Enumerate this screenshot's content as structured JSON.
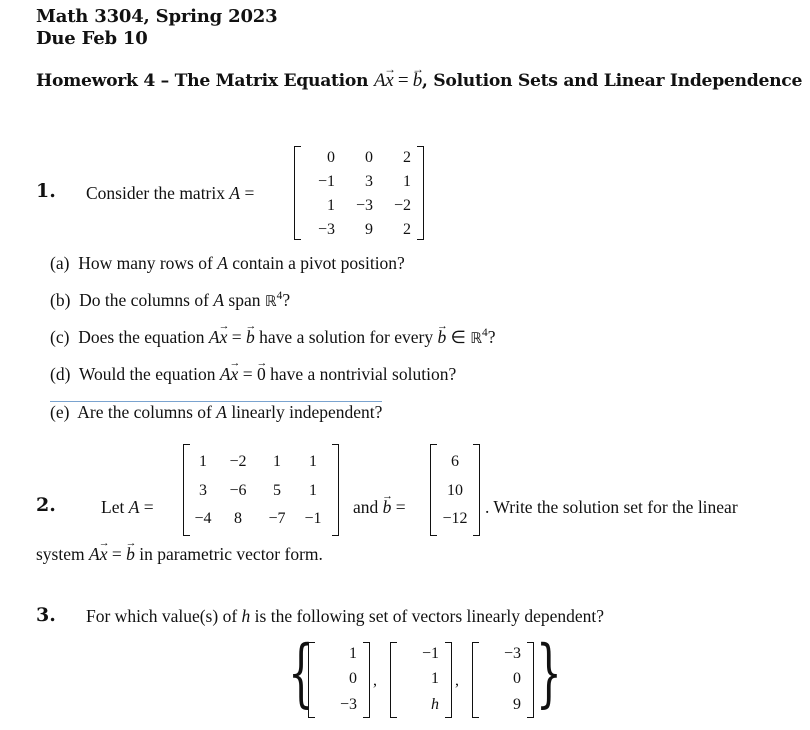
{
  "header": {
    "course": "Math 3304, Spring 2023",
    "due": "Due Feb 10"
  },
  "title": {
    "prefix": "Homework 4 – The Matrix Equation ",
    "eq_A": "A",
    "eq_x": "x",
    "eq_equals": " = ",
    "eq_b": "b",
    "suffix": ", Solution Sets and Linear Independence"
  },
  "problem1": {
    "number": "1.",
    "intro": "Consider the matrix ",
    "matrix_name": "A",
    "equals": " =",
    "matrix": [
      [
        "0",
        "0",
        "2"
      ],
      [
        "−1",
        "3",
        "1"
      ],
      [
        "1",
        "−3",
        "−2"
      ],
      [
        "−3",
        "9",
        "2"
      ]
    ],
    "parts": [
      {
        "label": "(a)",
        "text": "How many rows of A contain a pivot position?"
      },
      {
        "label": "(b)",
        "text": "Do the columns of A span ℝ⁴?"
      },
      {
        "label": "(c)",
        "text": "Does the equation Ax = b have a solution for every b ∈ ℝ⁴?"
      },
      {
        "label": "(d)",
        "text": "Would the equation Ax = 0 have a nontrivial solution?"
      },
      {
        "label": "(e)",
        "text": "Are the columns of A linearly independent?"
      }
    ],
    "part_a": {
      "pre": "How many rows of ",
      "A": "A",
      "post": " contain a pivot position?"
    },
    "part_b": {
      "pre": "Do the columns of ",
      "A": "A",
      "mid": " span ",
      "R": "ℝ",
      "exp": "4",
      "post": "?"
    },
    "part_c": {
      "pre": "Does the equation ",
      "A": "A",
      "x": "x",
      "eq": " = ",
      "b": "b",
      "mid": " have a solution for every ",
      "b2": "b",
      "in": " ∈ ",
      "R": "ℝ",
      "exp": "4",
      "post": "?"
    },
    "part_d": {
      "pre": "Would the equation ",
      "A": "A",
      "x": "x",
      "eq": " = ",
      "zero": "0",
      "post": " have a nontrivial solution?"
    },
    "part_e": {
      "pre": "Are the columns of ",
      "A": "A",
      "post": " linearly independent?"
    }
  },
  "problem2": {
    "number": "2.",
    "intro": "Let ",
    "matrix_name": "A",
    "equals": " =",
    "matrix": [
      [
        "1",
        "−2",
        "1",
        "1"
      ],
      [
        "3",
        "−6",
        "5",
        "1"
      ],
      [
        "−4",
        "8",
        "−7",
        "−1"
      ]
    ],
    "and": "and ",
    "b_name": "b",
    "b_equals": " =",
    "b_vector": [
      "6",
      "10",
      "−12"
    ],
    "after_vector": ".  Write the solution set for the linear",
    "line2_pre": "system ",
    "line2_A": "A",
    "line2_x": "x",
    "line2_eq": " = ",
    "line2_b": "b",
    "line2_post": " in parametric vector form."
  },
  "problem3": {
    "number": "3.",
    "text_pre": "For which value(s) of ",
    "h": "h",
    "text_post": " is the following set of vectors linearly dependent?",
    "vectors": [
      [
        "1",
        "0",
        "−3"
      ],
      [
        "−1",
        "1",
        "h"
      ],
      [
        "−3",
        "0",
        "9"
      ]
    ],
    "left_brace": "{",
    "right_brace": "}",
    "comma": ","
  }
}
